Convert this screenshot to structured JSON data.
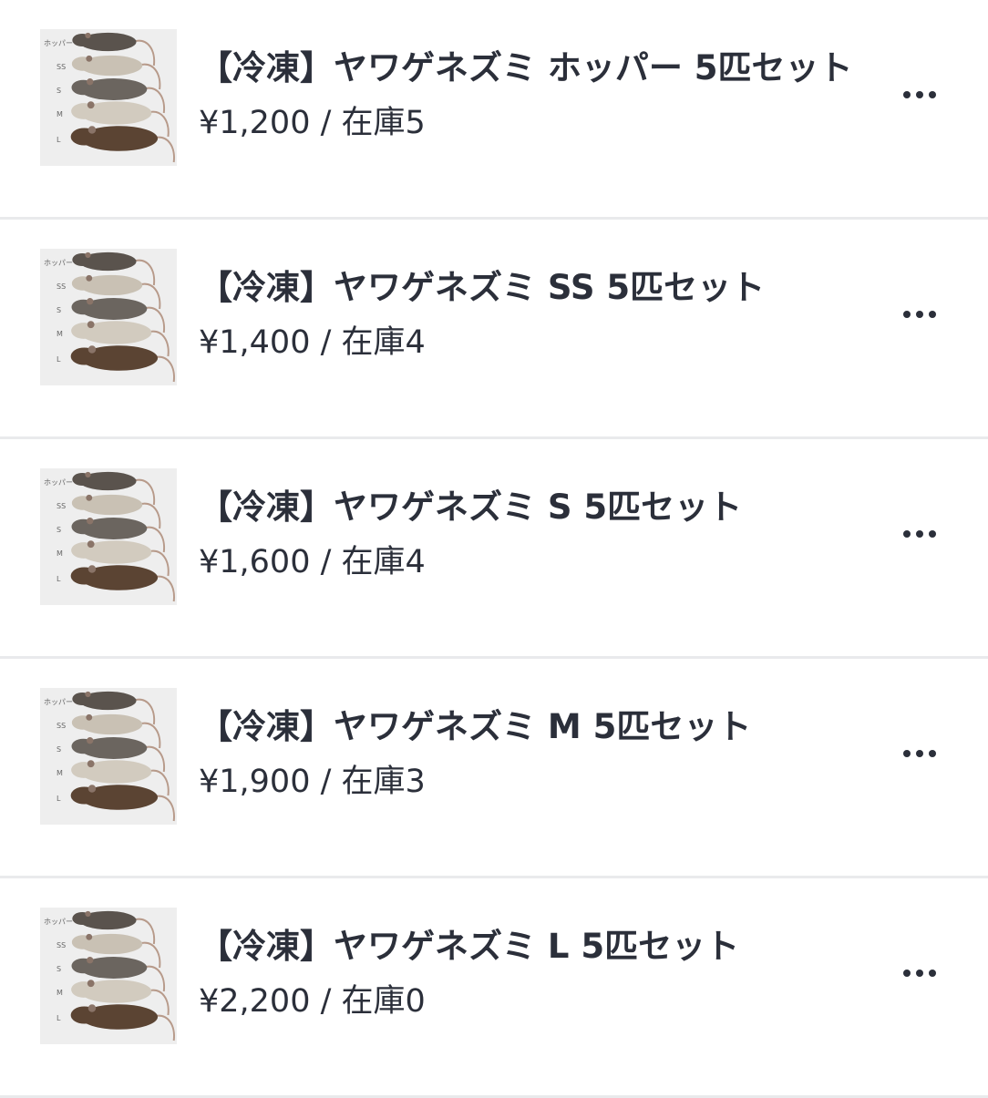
{
  "products": [
    {
      "title": "【冷凍】ヤワゲネズミ ホッパー 5匹セット",
      "price": "¥1,200",
      "separator": "/",
      "stock": "在庫5",
      "image_labels": [
        "ホッパー",
        "SS",
        "S",
        "M",
        "L"
      ],
      "menu_icon": "more-horizontal-icon"
    },
    {
      "title": "【冷凍】ヤワゲネズミ SS 5匹セット",
      "price": "¥1,400",
      "separator": "/",
      "stock": "在庫4",
      "image_labels": [
        "ホッパー",
        "SS",
        "S",
        "M",
        "L"
      ],
      "menu_icon": "more-horizontal-icon"
    },
    {
      "title": "【冷凍】ヤワゲネズミ S 5匹セット",
      "price": "¥1,600",
      "separator": "/",
      "stock": "在庫4",
      "image_labels": [
        "ホッパー",
        "SS",
        "S",
        "M",
        "L"
      ],
      "menu_icon": "more-horizontal-icon"
    },
    {
      "title": "【冷凍】ヤワゲネズミ M 5匹セット",
      "price": "¥1,900",
      "separator": "/",
      "stock": "在庫3",
      "image_labels": [
        "ホッパー",
        "SS",
        "S",
        "M",
        "L"
      ],
      "menu_icon": "more-horizontal-icon"
    },
    {
      "title": "【冷凍】ヤワゲネズミ L 5匹セット",
      "price": "¥2,200",
      "separator": "/",
      "stock": "在庫0",
      "image_labels": [
        "ホッパー",
        "SS",
        "S",
        "M",
        "L"
      ],
      "menu_icon": "more-horizontal-icon"
    }
  ],
  "colors": {
    "text": "#2b2f3a",
    "divider": "#e9eaec",
    "thumb_bg": "#eeeeee",
    "mouse_colors": [
      "#5a534d",
      "#c9c1b4",
      "#6b655f",
      "#d2cbbf",
      "#5b4433"
    ]
  }
}
